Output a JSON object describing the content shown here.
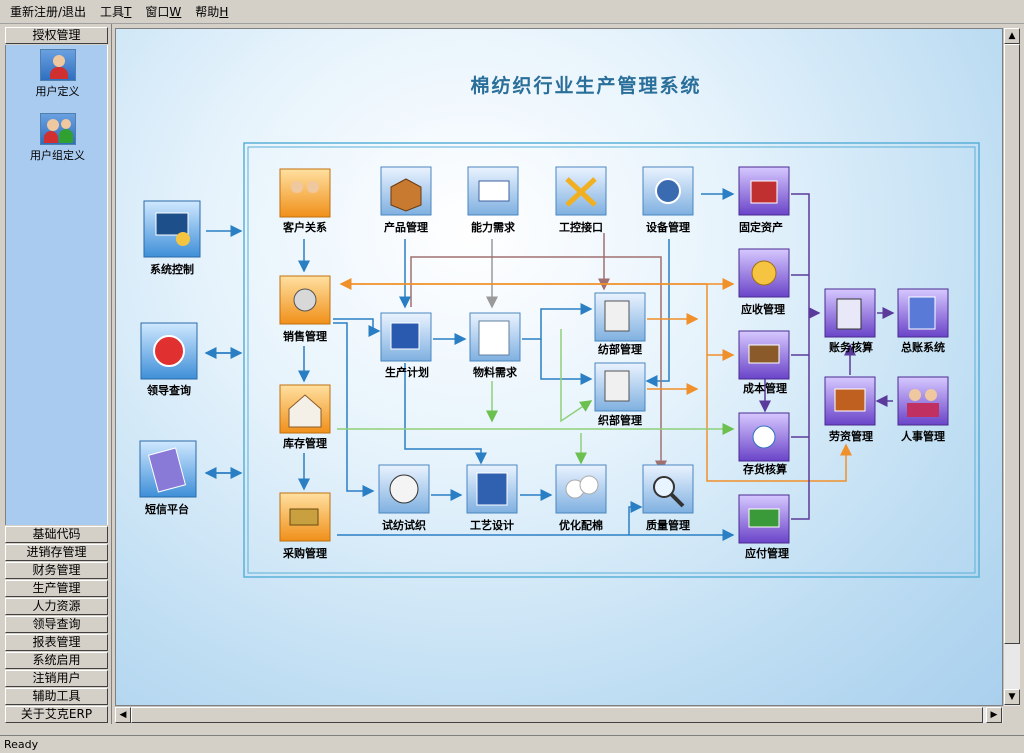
{
  "menubar": {
    "items": [
      {
        "label": "重新注册/退出",
        "accel": ""
      },
      {
        "label": "工具",
        "accel": "T"
      },
      {
        "label": "窗口",
        "accel": "W"
      },
      {
        "label": "帮助",
        "accel": "H"
      }
    ]
  },
  "sidebar": {
    "active_group": "授权管理",
    "tools": [
      {
        "label": "用户定义",
        "icon": "user-icon"
      },
      {
        "label": "用户组定义",
        "icon": "user-group-icon"
      }
    ],
    "groups": [
      "基础代码",
      "进销存管理",
      "财务管理",
      "生产管理",
      "人力资源",
      "领导查询",
      "报表管理",
      "系统启用",
      "注销用户",
      "辅助工具",
      "关于艾克ERP"
    ]
  },
  "main": {
    "title": "棉纺织行业生产管理系统",
    "modules": {
      "system_control": "系统控制",
      "leader_query": "领导查询",
      "sms_platform": "短信平台",
      "customer_relations": "客户关系",
      "sales": "销售管理",
      "inventory": "库存管理",
      "purchasing": "采购管理",
      "product": "产品管理",
      "production_plan": "生产计划",
      "capacity": "能力需求",
      "material": "物料需求",
      "control_interface": "工控接口",
      "equipment": "设备管理",
      "spinning": "纺部管理",
      "weaving": "织部管理",
      "trial": "试纺试织",
      "process_design": "工艺设计",
      "cotton_blend": "优化配棉",
      "quality": "质量管理",
      "fixed_assets": "固定资产",
      "receivables": "应收管理",
      "cost": "成本管理",
      "stock_accounting": "存货核算",
      "payables": "应付管理",
      "accounting": "账务核算",
      "ledger": "总账系统",
      "labor": "劳资管理",
      "hr": "人事管理"
    }
  },
  "status": {
    "text": "Ready"
  },
  "colors": {
    "accent_blue": "#2a7fc4",
    "flow_orange": "#f5a35a",
    "flow_green": "#8fd07a",
    "flow_purple": "#5a3a9a"
  }
}
